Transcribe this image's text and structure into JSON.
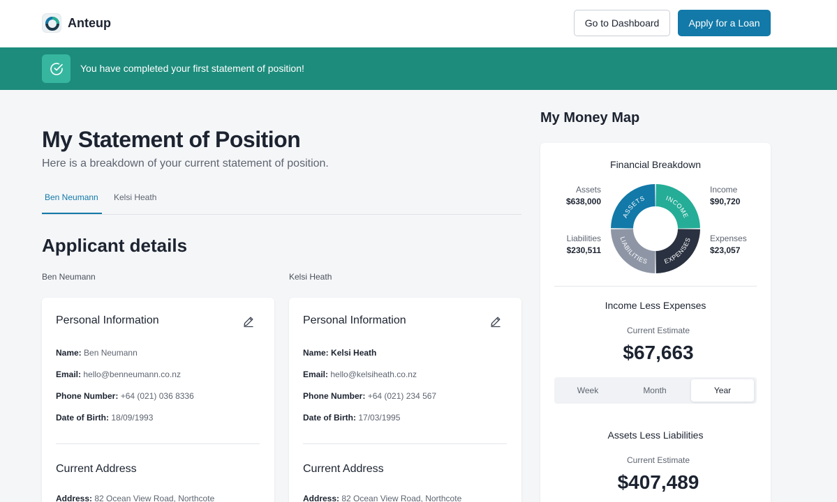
{
  "header": {
    "app_name": "Anteup",
    "dashboard_button": "Go to Dashboard",
    "apply_button": "Apply for a Loan"
  },
  "banner": {
    "message": "You have completed your first statement of position!"
  },
  "page": {
    "title": "My Statement of Position",
    "subtitle": "Here is a breakdown of your current statement of position.",
    "tabs": [
      {
        "label": "Ben Neumann",
        "active": true
      },
      {
        "label": "Kelsi Heath",
        "active": false
      }
    ]
  },
  "applicants": {
    "section_title": "Applicant details",
    "columns": [
      {
        "label": "Ben Neumann",
        "card_title": "Personal Information",
        "name_label": "Name:",
        "name": "Ben Neumann",
        "email_label": "Email:",
        "email": "hello@benneumann.co.nz",
        "phone_label": "Phone Number:",
        "phone": "+64 (021) 036 8336",
        "dob_label": "Date of Birth:",
        "dob": "18/09/1993",
        "address_title": "Current Address",
        "address_label": "Address:",
        "address": "82 Ocean View Road, Northcote"
      },
      {
        "label": "Kelsi Heath",
        "card_title": "Personal Information",
        "name_label": "Name:",
        "name": "Kelsi Heath",
        "email_label": "Email:",
        "email": "hello@kelsiheath.co.nz",
        "phone_label": "Phone Number:",
        "phone": "+64 (021) 234 567",
        "dob_label": "Date of Birth:",
        "dob": "17/03/1995",
        "address_title": "Current Address",
        "address_label": "Address:",
        "address": "82 Ocean View Road, Northcote"
      }
    ]
  },
  "money_map": {
    "title": "My Money Map",
    "breakdown_title": "Financial Breakdown",
    "segments": [
      {
        "label": "Assets",
        "value": "$638,000",
        "ring_text": "ASSETS",
        "color": "#1279a8"
      },
      {
        "label": "Income",
        "value": "$90,720",
        "ring_text": "INCOME",
        "color": "#25ad97"
      },
      {
        "label": "Expenses",
        "value": "$23,057",
        "ring_text": "EXPENSES",
        "color": "#2a3140"
      },
      {
        "label": "Liabilities",
        "value": "$230,511",
        "ring_text": "LIABILITIES",
        "color": "#8e96a6"
      }
    ],
    "income_less_expenses": {
      "title": "Income Less Expenses",
      "estimate_label": "Current Estimate",
      "value": "$67,663",
      "periods": [
        "Week",
        "Month",
        "Year"
      ],
      "selected_period": "Year"
    },
    "assets_less_liabilities": {
      "title": "Assets Less Liabilities",
      "estimate_label": "Current Estimate",
      "value": "$407,489"
    }
  }
}
